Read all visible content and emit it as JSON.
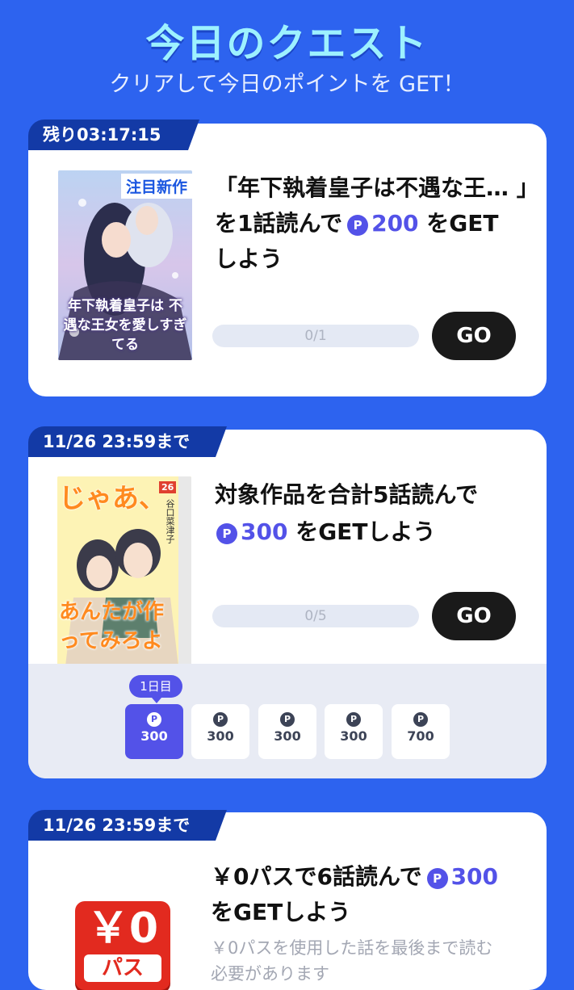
{
  "header": {
    "title": "今日のクエスト",
    "subtitle": "クリアして今日のポイントを GET！"
  },
  "quests": [
    {
      "tag": "残り03:17:15",
      "cover_badge": "注目新作",
      "cover_title": "年下執着皇子は 不遇な王女を愛しすぎてる",
      "line1": "「年下執着皇子は不遇な王… 」",
      "line2_prefix": "を1話読んで",
      "points": "200",
      "line2_suffix": "をGET",
      "line3": "しよう",
      "progress": "0/1",
      "go_label": "GO"
    },
    {
      "tag": "11/26 23:59まで",
      "cover_title_top": "じゃあ、",
      "cover_volume": "26",
      "cover_author": "谷口菜津子",
      "cover_title_bottom": "あんたが作ってみろよ",
      "line1": "対象作品を合計5話読んで",
      "points": "300",
      "line2_suffix": "をGETしよう",
      "progress": "0/5",
      "go_label": "GO",
      "streak_label": "1日目",
      "streak": [
        {
          "value": "300",
          "active": true
        },
        {
          "value": "300",
          "active": false
        },
        {
          "value": "300",
          "active": false
        },
        {
          "value": "300",
          "active": false
        },
        {
          "value": "700",
          "active": false
        }
      ]
    },
    {
      "tag": "11/26 23:59まで",
      "line1_prefix": "￥0パスで6話読んで",
      "points": "300",
      "line2": "をGETしよう",
      "note_line1": "￥0パスを使用した話を最後まで読む",
      "note_line2": "必要があります",
      "cover_big": "￥0",
      "cover_sub": "パス"
    }
  ],
  "colors": {
    "background": "#2d63ef",
    "accent": "#5352e8",
    "tag": "#133aa6",
    "title": "#9df1ff"
  },
  "icons": {
    "point": "point-icon"
  }
}
